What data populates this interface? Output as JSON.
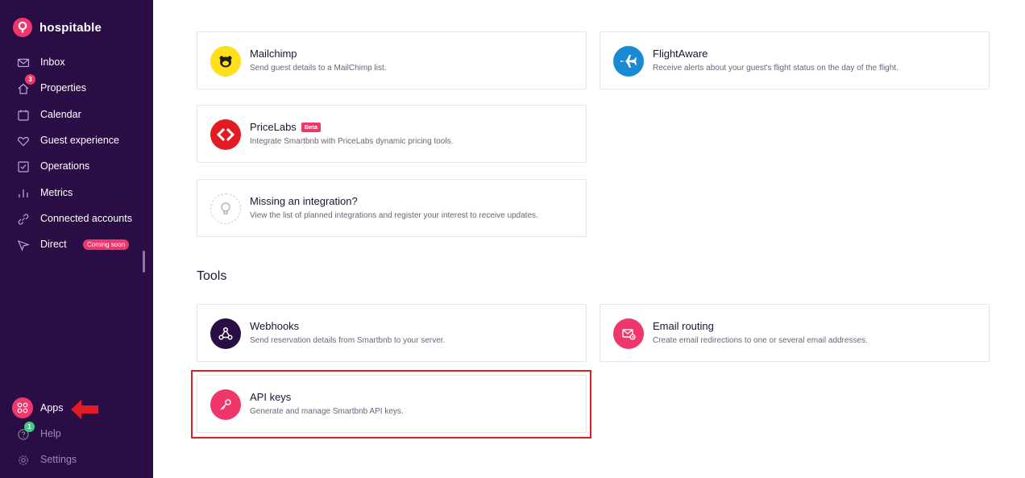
{
  "brand": {
    "name": "hospitable"
  },
  "sidebar": {
    "items": [
      {
        "label": "Inbox",
        "icon": "mail-icon"
      },
      {
        "label": "Properties",
        "icon": "home-icon",
        "badge": "3"
      },
      {
        "label": "Calendar",
        "icon": "calendar-icon"
      },
      {
        "label": "Guest experience",
        "icon": "heart-icon"
      },
      {
        "label": "Operations",
        "icon": "checkbox-icon"
      },
      {
        "label": "Metrics",
        "icon": "bar-chart-icon"
      },
      {
        "label": "Connected accounts",
        "icon": "link-icon"
      },
      {
        "label": "Direct",
        "icon": "send-icon",
        "pill": "Coming soon"
      }
    ],
    "bottom": [
      {
        "label": "Apps",
        "icon": "apps-grid-icon"
      },
      {
        "label": "Help",
        "icon": "help-icon",
        "badge": "1"
      },
      {
        "label": "Settings",
        "icon": "gear-icon"
      }
    ]
  },
  "integrations": [
    {
      "title": "Mailchimp",
      "description": "Send guest details to a MailChimp list.",
      "icon": "mailchimp-icon",
      "color": "#ffe01b"
    },
    {
      "title": "FlightAware",
      "description": "Receive alerts about your guest's flight status on the day of the flight.",
      "icon": "plane-icon",
      "color": "#1a8ad4"
    },
    {
      "title": "PriceLabs",
      "badge": "Beta",
      "description": "Integrate Smartbnb with PriceLabs dynamic pricing tools.",
      "icon": "pricelabs-icon",
      "color": "#e31b23"
    },
    {
      "title": "Missing an integration?",
      "description": "View the list of planned integrations and register your interest to receive updates.",
      "icon": "lightbulb-icon"
    }
  ],
  "tools": {
    "heading": "Tools",
    "items": [
      {
        "title": "Webhooks",
        "description": "Send reservation details from Smartbnb to your server.",
        "icon": "webhook-icon",
        "color": "#2a0d45"
      },
      {
        "title": "Email routing",
        "description": "Create email redirections to one or several email addresses.",
        "icon": "email-route-icon",
        "color": "#f0376b"
      },
      {
        "title": "API keys",
        "description": "Generate and manage Smartbnb API keys.",
        "icon": "key-icon",
        "color": "#f0376b"
      }
    ]
  },
  "colors": {
    "sidebar": "#2a0d45",
    "accent": "#f0376b",
    "success": "#3fcc8a",
    "highlight": "#e01b24"
  }
}
